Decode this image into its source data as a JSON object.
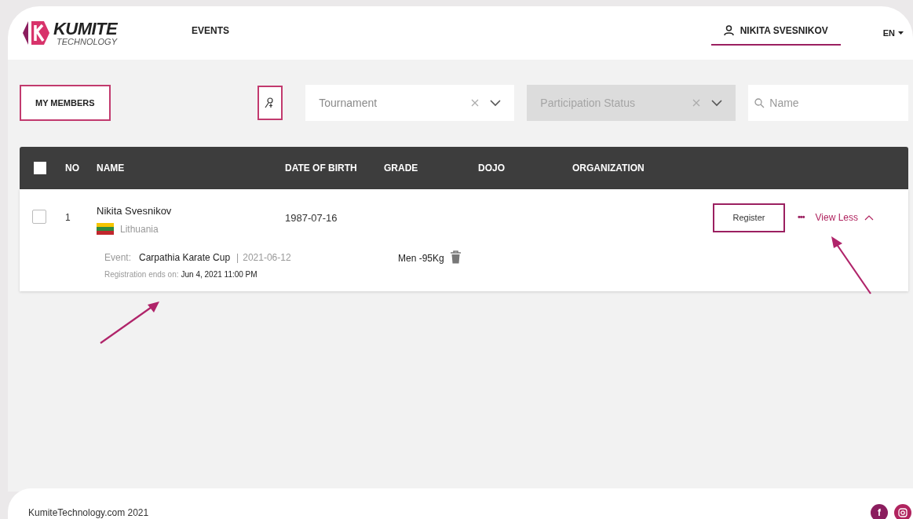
{
  "header": {
    "logo": {
      "name": "KUMITE",
      "sub": "TECHNOLOGY"
    },
    "nav": [
      {
        "label": "EVENTS",
        "selected": false
      }
    ],
    "user": {
      "name": "NIKITA SVESNIKOV",
      "selected": true
    },
    "language": "EN"
  },
  "toolbar": {
    "tab": {
      "label": "MY MEMBERS",
      "selected": true
    },
    "filters": [
      {
        "kind": "select",
        "placeholder": "Tournament",
        "disabled": false
      },
      {
        "kind": "select",
        "placeholder": "Participation Status",
        "disabled": true
      },
      {
        "kind": "search",
        "placeholder": "Name",
        "disabled": false
      }
    ]
  },
  "table": {
    "select_all": {
      "checked": false
    },
    "columns": [
      "NO",
      "NAME",
      "DATE OF BIRTH",
      "GRADE",
      "DOJO",
      "ORGANIZATION"
    ],
    "rows": [
      {
        "checked": false,
        "no": "1",
        "name": "Nikita Svesnikov",
        "country": "Lithuania",
        "date_of_birth": "1987-07-16",
        "register": "Register",
        "more": "•••",
        "toggle": "View Less",
        "expanded": true,
        "event": {
          "label": "Event:",
          "name": "Carpathia Karate Cup",
          "separator": "|",
          "date": "2021-06-12",
          "category": "Men -95Kg",
          "deadline_label": "Registration ends on:",
          "deadline": "Jun 4, 2021 11:00 PM"
        }
      }
    ]
  },
  "footer": {
    "copyright": "KumiteTechnology.com 2021",
    "facebook_glyph": "f"
  }
}
